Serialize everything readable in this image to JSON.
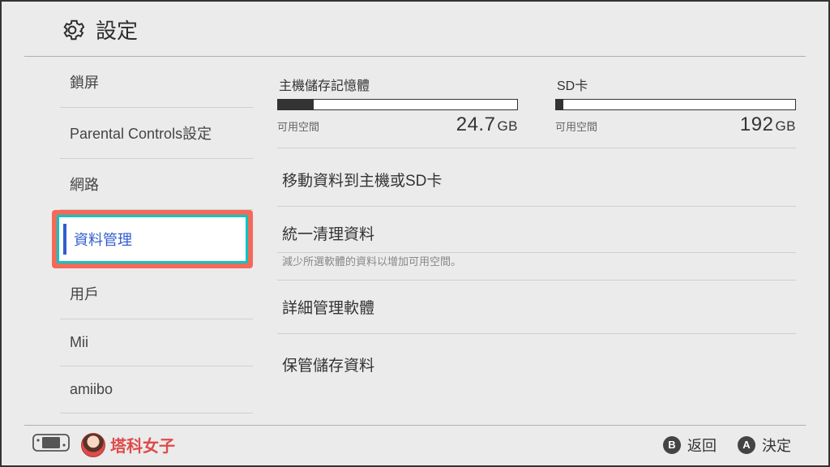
{
  "header": {
    "title": "設定"
  },
  "sidebar": {
    "items": [
      {
        "label": "鎖屏"
      },
      {
        "label": "Parental Controls設定"
      },
      {
        "label": "網路"
      },
      {
        "label": "資料管理",
        "selected": true
      },
      {
        "label": "用戶"
      },
      {
        "label": "Mii"
      },
      {
        "label": "amiibo"
      }
    ]
  },
  "storage": {
    "system": {
      "label": "主機儲存記憶體",
      "free_label": "可用空間",
      "free_value": "24.7",
      "unit": "GB",
      "fill_pct": 15
    },
    "sd": {
      "label": "SD卡",
      "free_label": "可用空間",
      "free_value": "192",
      "unit": "GB",
      "fill_pct": 3
    }
  },
  "options": {
    "move": "移動資料到主機或SD卡",
    "cleanup": "統一清理資料",
    "cleanup_help": "減少所選軟體的資料以增加可用空間。",
    "detail": "詳細管理軟體",
    "archive": "保管儲存資料"
  },
  "footer": {
    "watermark": "塔科女子",
    "back": {
      "btn": "B",
      "label": "返回"
    },
    "select": {
      "btn": "A",
      "label": "決定"
    }
  }
}
